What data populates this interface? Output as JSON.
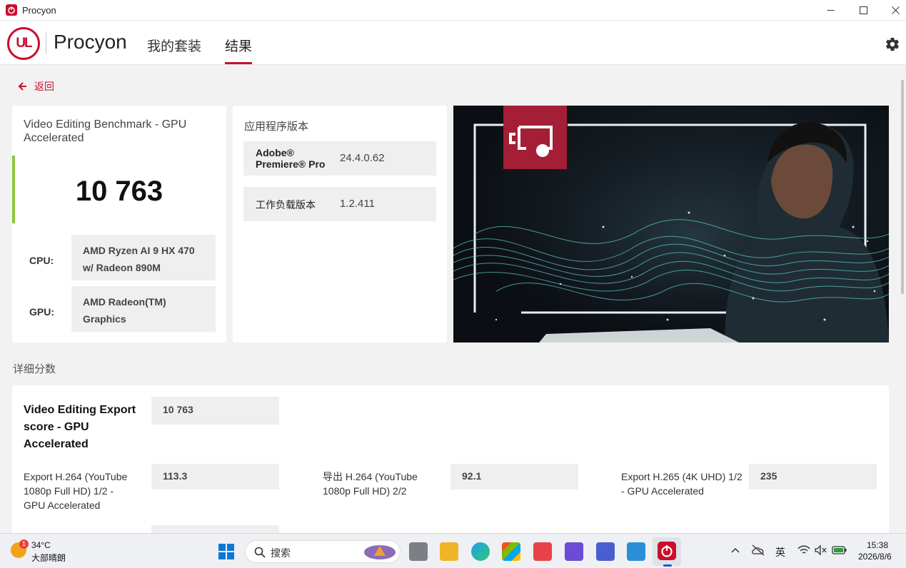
{
  "window": {
    "title": "Procyon",
    "minimize": "—",
    "maximize": "☐",
    "close": "✕"
  },
  "header": {
    "logo_mark": "UL",
    "brand": "Procyon",
    "nav": [
      {
        "label": "我的套装",
        "active": false
      },
      {
        "label": "结果",
        "active": true
      }
    ]
  },
  "back_label": "返回",
  "score_card": {
    "title": "Video Editing Benchmark - GPU Accelerated",
    "score": "10 763",
    "cpu_label": "CPU:",
    "cpu_value": "AMD Ryzen AI 9 HX 470 w/ Radeon 890M",
    "gpu_label": "GPU:",
    "gpu_value": "AMD Radeon(TM) Graphics"
  },
  "version_card": {
    "title": "应用程序版本",
    "rows": [
      {
        "name": "Adobe® Premiere® Pro",
        "value": "24.4.0.62"
      },
      {
        "name": "工作负载版本",
        "value": "1.2.411"
      }
    ]
  },
  "details": {
    "section_title": "详细分数",
    "main_label": "Video Editing Export score - GPU Accelerated",
    "main_value": "10 763",
    "items": [
      {
        "label": "Export H.264 (YouTube 1080p Full HD) 1/2 - GPU Accelerated",
        "value": "113.3"
      },
      {
        "label": "导出 H.264 (YouTube 1080p Full HD) 2/2",
        "value": "92.1"
      },
      {
        "label": "Export H.265 (4K UHD) 1/2 - GPU Accelerated",
        "value": "235"
      }
    ]
  },
  "taskbar": {
    "weather_badge": "1",
    "temperature": "34°C",
    "weather_desc": "大部晴朗",
    "search_placeholder": "搜索",
    "ime": "英",
    "time": "15:38",
    "date": "2026/8/6"
  },
  "colors": {
    "brand_red": "#c8102e",
    "score_green": "#8cc63f"
  }
}
